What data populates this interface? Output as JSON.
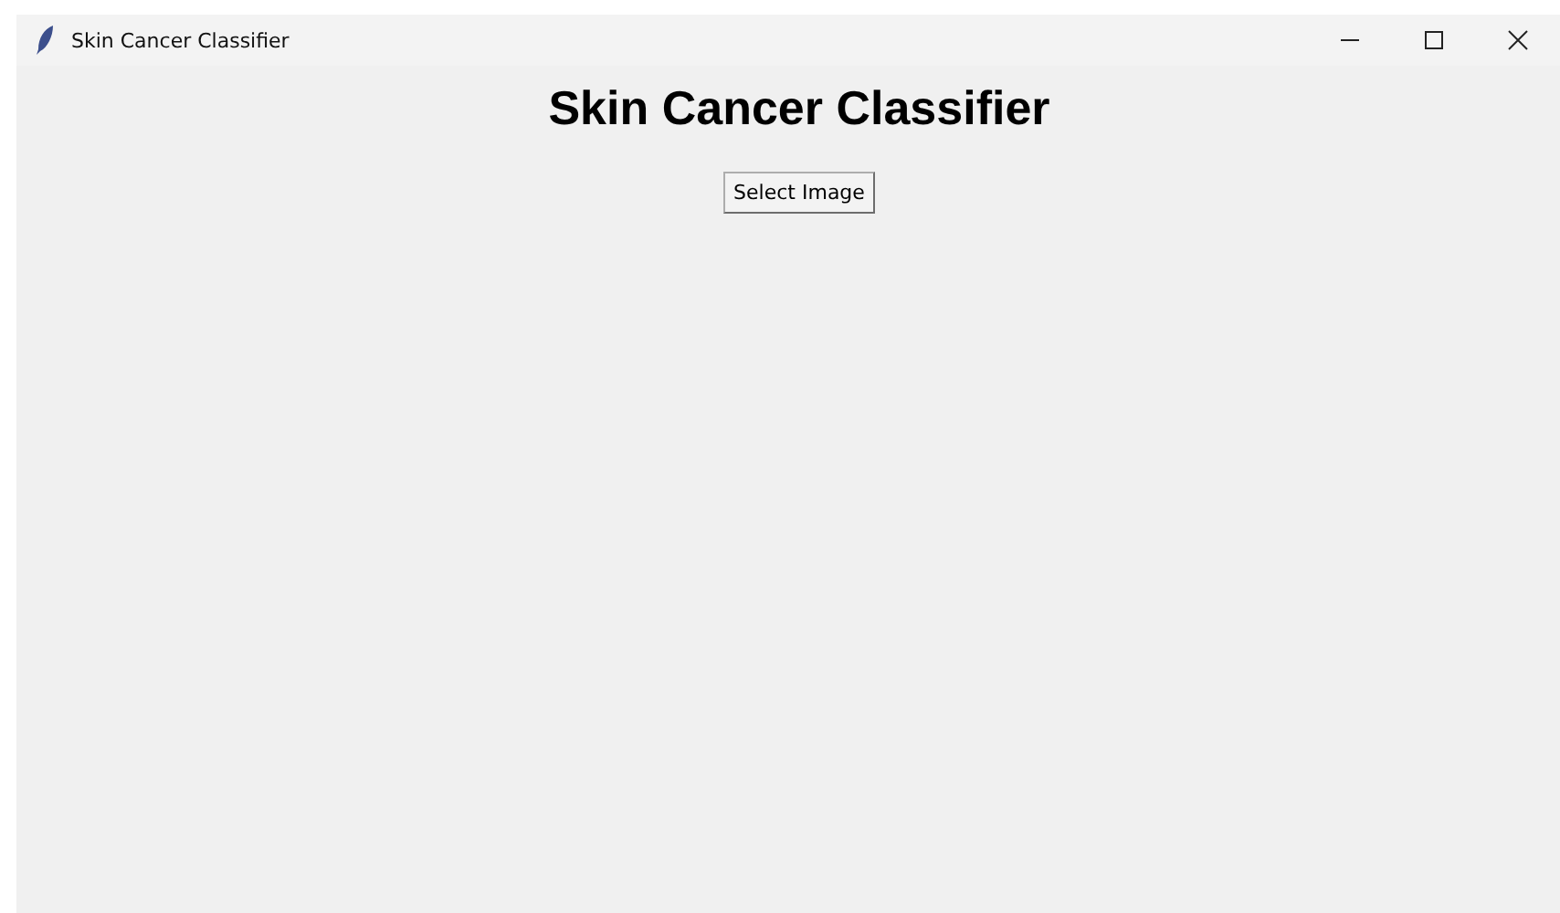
{
  "window": {
    "title": "Skin Cancer Classifier"
  },
  "heading": "Skin Cancer Classifier",
  "buttons": [
    "Select Image"
  ]
}
